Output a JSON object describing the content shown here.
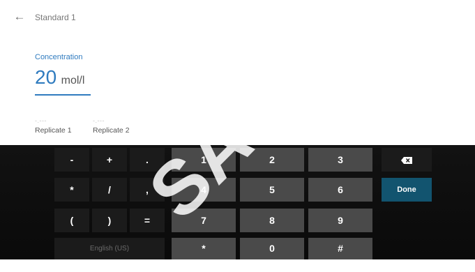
{
  "header": {
    "title": "Standard 1"
  },
  "concentration": {
    "label": "Concentration",
    "value": "20",
    "unit": "mol/l"
  },
  "replicates": [
    {
      "value": "-.---",
      "label": "Replicate 1"
    },
    {
      "value": "-.---",
      "label": "Replicate 2"
    }
  ],
  "keyboard": {
    "symbol_keys": [
      "-",
      "+",
      ".",
      "*",
      "/",
      ",",
      "(",
      ")",
      "="
    ],
    "number_keys": [
      "1",
      "2",
      "3",
      "4",
      "5",
      "6",
      "7",
      "8",
      "9",
      "*",
      "0",
      "#"
    ],
    "language": "English (US)",
    "done_label": "Done"
  },
  "colors": {
    "accent": "#2f7bbf",
    "done": "#12546f",
    "keyboard_bg": "#0e0e0e",
    "number_key": "#4a4a4a",
    "symbol_key": "#1b1b1b"
  },
  "watermark": "SAMPLE DUTS"
}
